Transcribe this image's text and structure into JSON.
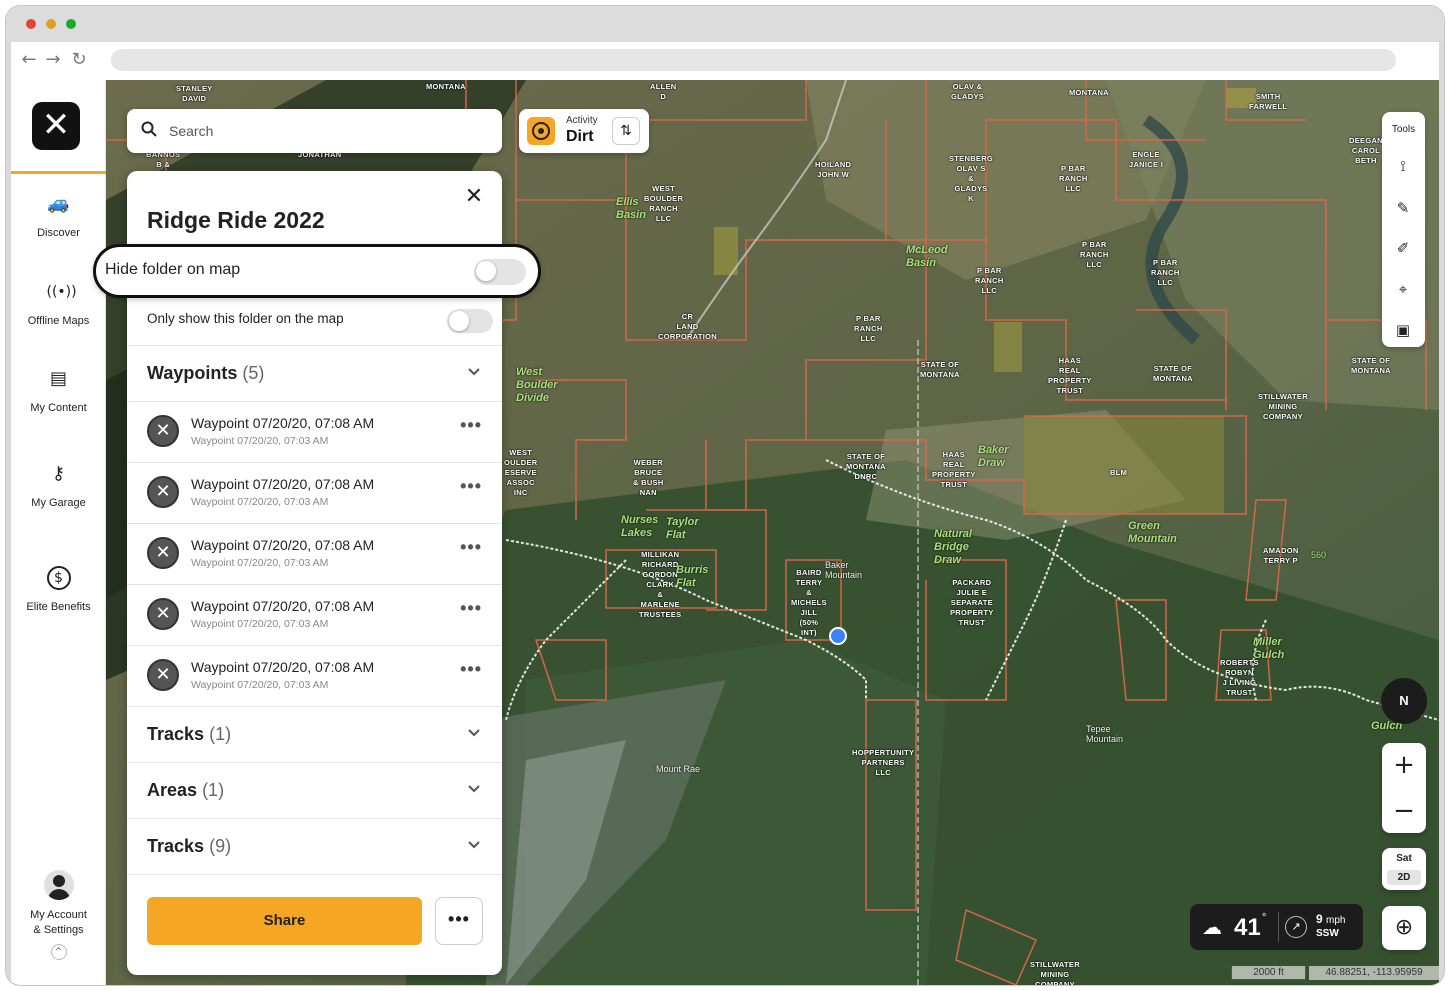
{
  "sidebar": {
    "logo_glyph": "✕",
    "items": [
      {
        "label": "Discover",
        "icon": "car-icon"
      },
      {
        "label": "Offline Maps",
        "icon": "offline-signal-icon"
      },
      {
        "label": "My Content",
        "icon": "folder-icon"
      },
      {
        "label": "My Garage",
        "icon": "keys-icon"
      },
      {
        "label": "Elite Benefits",
        "icon": "dollar-icon"
      }
    ],
    "account_label": "My Account\n& Settings"
  },
  "search": {
    "placeholder": "Search"
  },
  "activity": {
    "small_label": "Activity",
    "value": "Dirt"
  },
  "panel": {
    "title": "Ridge Ride 2022",
    "hide_folder_label": "Hide folder on map",
    "only_show_label": "Only show this folder on the map",
    "waypoints_title": "Waypoints",
    "waypoints_count": "(5)",
    "waypoints": [
      {
        "title": "Waypoint 07/20/20, 07:08 AM",
        "subtitle": "Waypoint 07/20/20, 07:03 AM"
      },
      {
        "title": "Waypoint 07/20/20, 07:08 AM",
        "subtitle": "Waypoint 07/20/20, 07:03 AM"
      },
      {
        "title": "Waypoint 07/20/20, 07:08 AM",
        "subtitle": "Waypoint 07/20/20, 07:03 AM"
      },
      {
        "title": "Waypoint 07/20/20, 07:08 AM",
        "subtitle": "Waypoint 07/20/20, 07:03 AM"
      },
      {
        "title": "Waypoint 07/20/20, 07:08 AM",
        "subtitle": "Waypoint 07/20/20, 07:03 AM"
      }
    ],
    "sections": [
      {
        "title": "Tracks",
        "count": "(1)"
      },
      {
        "title": "Areas",
        "count": "(1)"
      },
      {
        "title": "Tracks",
        "count": "(9)"
      }
    ],
    "share_label": "Share",
    "more_glyph": "•••"
  },
  "tools": {
    "title": "Tools"
  },
  "compass": {
    "label": "N"
  },
  "layer": {
    "type": "Sat",
    "mode": "2D"
  },
  "weather": {
    "temp": "41",
    "deg": "°",
    "speed": "9",
    "unit": "mph",
    "direction": "SSW"
  },
  "scale": {
    "label": "2000 ft"
  },
  "coords": {
    "label": "46.88251, -113.95959"
  },
  "map_labels": [
    {
      "text": "STANLEY\nDAVID"
    },
    {
      "text": "MONTANA"
    },
    {
      "text": "ALLEN\nD"
    },
    {
      "text": "OLAV &\nGLADYS"
    },
    {
      "text": "MONTANA"
    },
    {
      "text": "SMITH\nFARWELL"
    },
    {
      "text": "DEEGAN\nCAROL\nBETH"
    },
    {
      "text": "BANNOS\nB &"
    },
    {
      "text": "JONATHAN"
    },
    {
      "text": "HOILAND\nJOHN W"
    },
    {
      "text": "STENBERG\nOLAV S\n&\nGLADYS\nK"
    },
    {
      "text": "P BAR\nRANCH\nLLC"
    },
    {
      "text": "ENGLE\nJANICE I"
    },
    {
      "text": "WEST\nBOULDER\nRANCH\nLLC"
    },
    {
      "text": "P BAR\nRANCH\nLLC"
    },
    {
      "text": "P BAR\nRANCH\nLLC"
    },
    {
      "text": "P BAR\nRANCH\nLLC"
    },
    {
      "text": "CR\nLAND\nCORPORATION"
    },
    {
      "text": "P BAR\nRANCH\nLLC"
    },
    {
      "text": "STATE OF\nMONTANA"
    },
    {
      "text": "HAAS\nREAL\nPROPERTY\nTRUST"
    },
    {
      "text": "STATE OF\nMONTANA"
    },
    {
      "text": "STATE OF\nMONTANA"
    },
    {
      "text": "STILLWATER\nMINING\nCOMPANY"
    },
    {
      "text": "WEST\nOULDER\nESERVE\nASSOC\nINC"
    },
    {
      "text": "WEBER\nBRUCE\n& BUSH\nNAN"
    },
    {
      "text": "STATE OF\nMONTANA\nDNRC"
    },
    {
      "text": "HAAS\nREAL\nPROPERTY\nTRUST"
    },
    {
      "text": "BLM"
    },
    {
      "text": "AMADON\nTERRY P"
    },
    {
      "text": "MILLIKAN\nRICHARD\nGORDON\nCLARK\n&\nMARLENE\nTRUSTEES"
    },
    {
      "text": "BAIRD\nTERRY\n&\nMICHELS\nJILL\n(50%\nINT)"
    },
    {
      "text": "PACKARD\nJULIE E\nSEPARATE\nPROPERTY\nTRUST"
    },
    {
      "text": "ROBERTS\nROBYN\nJ LIVING\nTRUST"
    },
    {
      "text": "HOPPERTUNITY\nPARTNERS\nLLC"
    },
    {
      "text": "STILLWATER\nMINING\nCOMPANY"
    }
  ],
  "map_places": [
    {
      "text": "Ellis\nBasin"
    },
    {
      "text": "McLeod\nBasin"
    },
    {
      "text": "West\nBoulder\nDivide"
    },
    {
      "text": "Baker\nDraw"
    },
    {
      "text": "Taylor\nFlat"
    },
    {
      "text": "Burris\nFlat"
    },
    {
      "text": "Natural\nBridge\nDraw"
    },
    {
      "text": "Green\nMountain"
    },
    {
      "text": "Nurses\nLakes"
    },
    {
      "text": "Miller\nGulch"
    },
    {
      "text": "Gulch"
    }
  ],
  "map_peaks": [
    {
      "text": "Baker\nMountain"
    },
    {
      "text": "Tepee\nMountain"
    },
    {
      "text": "Mount Rae"
    },
    {
      "text": "560"
    }
  ]
}
